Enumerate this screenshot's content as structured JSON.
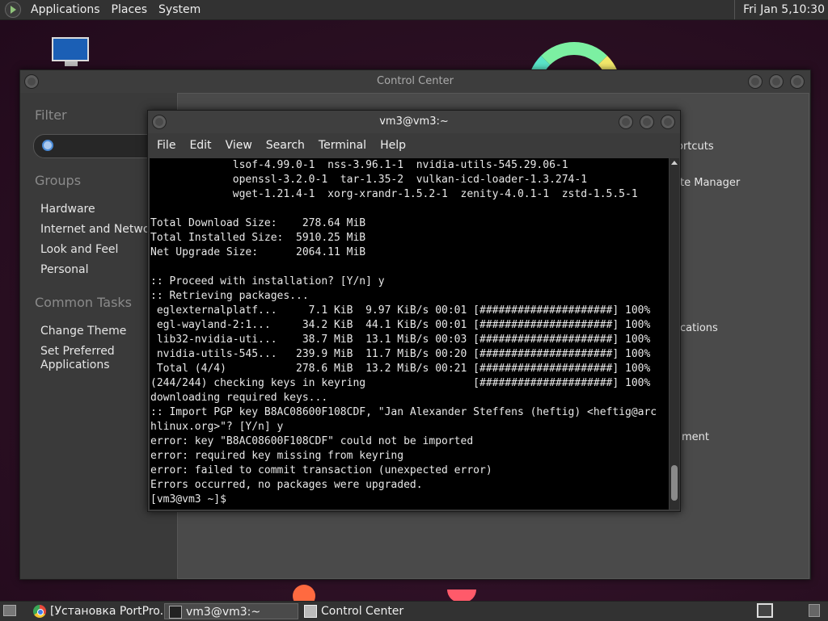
{
  "top_panel": {
    "menus": [
      "Applications",
      "Places",
      "System"
    ],
    "clock": "Fri Jan  5,10:30"
  },
  "control_center": {
    "title": "Control Center",
    "filter_label": "Filter",
    "groups_label": "Groups",
    "groups": [
      "Hardware",
      "Internet and Network",
      "Look and Feel",
      "Personal"
    ],
    "common_tasks_label": "Common Tasks",
    "tasks": [
      "Change Theme",
      "Set Preferred\nApplications"
    ],
    "partial_items": [
      "ortcuts",
      "te Manager",
      "cations",
      "ment"
    ]
  },
  "terminal": {
    "title": "vm3@vm3:~",
    "menu": [
      "File",
      "Edit",
      "View",
      "Search",
      "Terminal",
      "Help"
    ],
    "lines": [
      "             lsof-4.99.0-1  nss-3.96.1-1  nvidia-utils-545.29.06-1",
      "             openssl-3.2.0-1  tar-1.35-2  vulkan-icd-loader-1.3.274-1",
      "             wget-1.21.4-1  xorg-xrandr-1.5.2-1  zenity-4.0.1-1  zstd-1.5.5-1",
      "",
      "Total Download Size:    278.64 MiB",
      "Total Installed Size:  5910.25 MiB",
      "Net Upgrade Size:      2064.11 MiB",
      "",
      ":: Proceed with installation? [Y/n] y",
      ":: Retrieving packages...",
      " eglexternalplatf...     7.1 KiB  9.97 KiB/s 00:01 [#####################] 100%",
      " egl-wayland-2:1...     34.2 KiB  44.1 KiB/s 00:01 [#####################] 100%",
      " lib32-nvidia-uti...    38.7 MiB  13.1 MiB/s 00:03 [#####################] 100%",
      " nvidia-utils-545...   239.9 MiB  11.7 MiB/s 00:20 [#####################] 100%",
      " Total (4/4)           278.6 MiB  13.2 MiB/s 00:21 [#####################] 100%",
      "(244/244) checking keys in keyring                 [#####################] 100%",
      "downloading required keys...",
      ":: Import PGP key B8AC08600F108CDF, \"Jan Alexander Steffens (heftig) <heftig@arc",
      "hlinux.org>\"? [Y/n] y",
      "error: key \"B8AC08600F108CDF\" could not be imported",
      "error: required key missing from keyring",
      "error: failed to commit transaction (unexpected error)",
      "Errors occurred, no packages were upgraded.",
      "[vm3@vm3 ~]$ "
    ]
  },
  "taskbar": {
    "tasks": [
      "[Установка PortPro...",
      "vm3@vm3:~",
      "Control Center"
    ]
  },
  "icons": {
    "menu": "mate-menu-icon",
    "computer": "computer-icon",
    "search": "search-icon",
    "browser": "chrome-icon",
    "terminal": "terminal-icon",
    "control_center": "control-center-icon",
    "workspace": "workspace-switcher-icon",
    "trash": "trash-icon"
  }
}
